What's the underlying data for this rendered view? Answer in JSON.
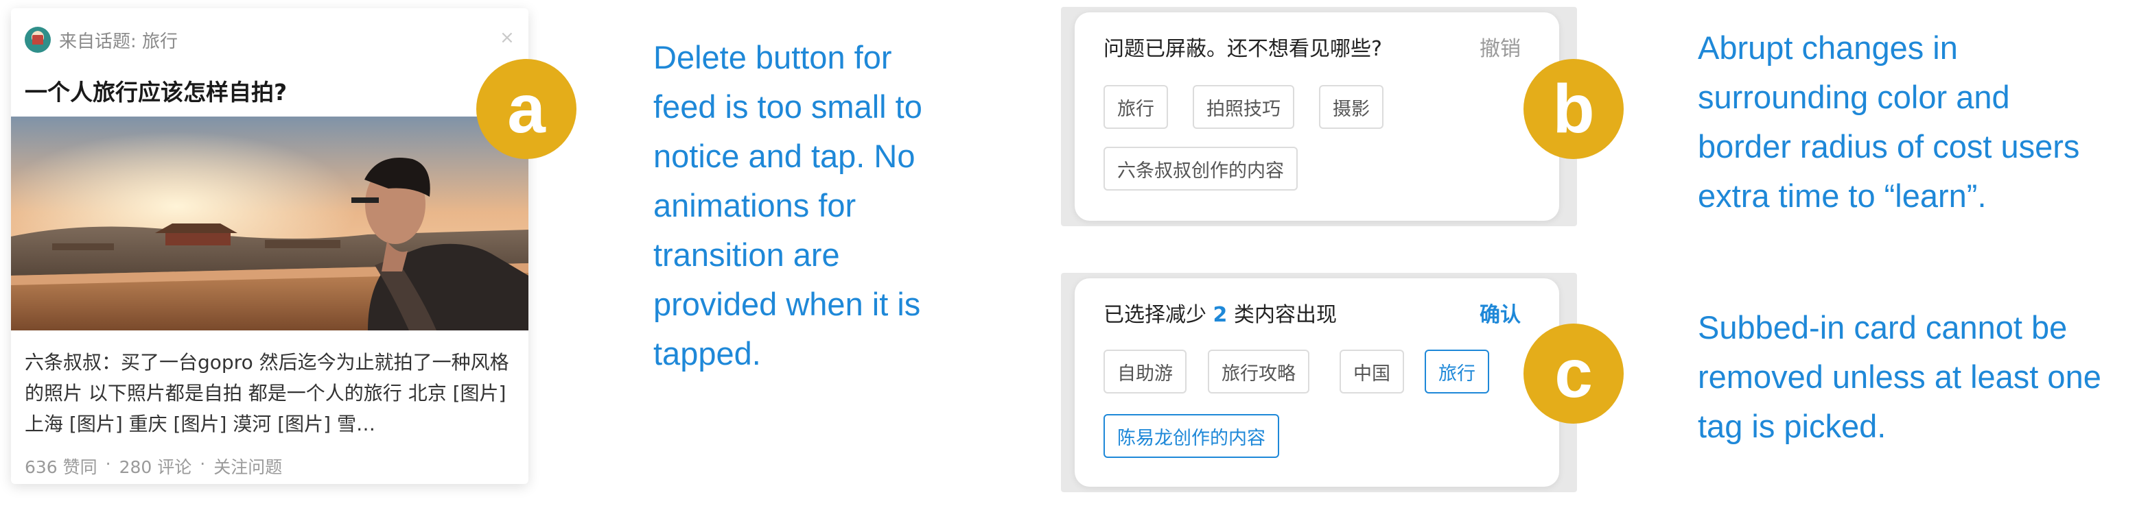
{
  "card_a": {
    "topic": "来自话题: 旅行",
    "close_glyph": "×",
    "title": "一个人旅行应该怎样自拍?",
    "excerpt": "六条叔叔：买了一台gopro 然后迄今为止就拍了一种风格的照片 以下照片都是自拍 都是一个人的旅行 北京 [图片] 上海 [图片] 重庆 [图片] 漠河 [图片] 雪…",
    "likes": "636 赞同",
    "comments": "280 评论",
    "follow": "关注问题",
    "dot": "·"
  },
  "badges": {
    "a": "a",
    "b": "b",
    "c": "c"
  },
  "notes": {
    "a": [
      "Delete button for",
      "feed is too small to",
      "notice and tap. No",
      "animations for",
      "transition are",
      "provided when it is",
      "tapped."
    ],
    "b": [
      "Abrupt changes in",
      "surrounding color and",
      "border radius of cost users",
      "extra time to “learn”."
    ],
    "c": [
      "Subbed-in card cannot be",
      "removed unless at least one",
      "tag is picked."
    ]
  },
  "panel_b": {
    "title": "问题已屏蔽。还不想看见哪些?",
    "undo": "撤销",
    "tags": [
      "旅行",
      "拍照技巧",
      "摄影",
      "六条叔叔创作的内容"
    ]
  },
  "panel_c": {
    "title_prefix": "已选择减少",
    "count": "2",
    "title_suffix": "类内容出现",
    "confirm": "确认",
    "tags": [
      "自助游",
      "旅行攻略",
      "中国",
      "旅行",
      "陈易龙创作的内容"
    ],
    "selected": [
      "旅行",
      "陈易龙创作的内容"
    ]
  },
  "colors": {
    "accent": "#1e88d8",
    "badge": "#e4ad1a"
  }
}
